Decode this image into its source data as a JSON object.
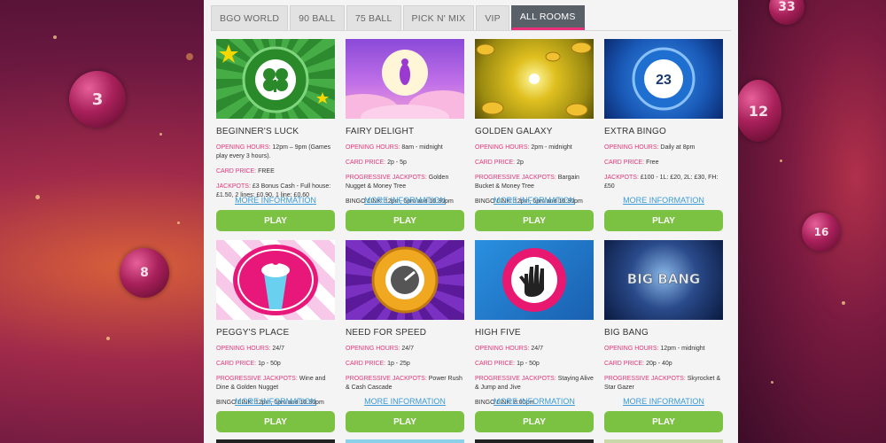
{
  "tabs": [
    {
      "label": "BGO WORLD",
      "active": false
    },
    {
      "label": "90 BALL",
      "active": false
    },
    {
      "label": "75 BALL",
      "active": false
    },
    {
      "label": "PICK N' MIX",
      "active": false
    },
    {
      "label": "VIP",
      "active": false
    },
    {
      "label": "ALL ROOMS",
      "active": true
    }
  ],
  "labels": {
    "opening_hours": "OPENING HOURS:",
    "card_price": "CARD PRICE:",
    "progressive_jackpots": "PROGRESSIVE JACKPOTS:",
    "jackpots": "JACKPOTS:",
    "more_info": "MORE INFORMATION",
    "play": "PLAY"
  },
  "rooms": [
    {
      "title": "BEGINNER'S LUCK",
      "hours": "12pm – 9pm (Games play every 3 hours).",
      "price": "FREE",
      "jackpot_label": "JACKPOTS:",
      "jackpots": "£3 Bonus Cash - Full house: £1.50, 2 lines: £0.90, 1 line: £0.60",
      "bingo_line": ""
    },
    {
      "title": "FAIRY DELIGHT",
      "hours": "8am - midnight",
      "price": "2p - 5p",
      "jackpot_label": "PROGRESSIVE JACKPOTS:",
      "jackpots": "Golden Nugget & Money Tree",
      "bingo_line": "BINGO LINK: 12pm, 6pm and 10:30pm"
    },
    {
      "title": "GOLDEN GALAXY",
      "hours": "2pm - midnight",
      "price": "2p",
      "jackpot_label": "PROGRESSIVE JACKPOTS:",
      "jackpots": "Bargain Bucket & Money Tree",
      "bingo_line": "BINGO LINK: 12pm, 6pm and 10:30pm"
    },
    {
      "title": "EXTRA BINGO",
      "hours": "Daily at 8pm",
      "price": "Free",
      "jackpot_label": "JACKPOTS:",
      "jackpots": "£100 - 1L: £20, 2L: £30, FH: £50",
      "bingo_line": ""
    },
    {
      "title": "PEGGY'S PLACE",
      "hours": "24/7",
      "price": "1p - 50p",
      "jackpot_label": "PROGRESSIVE JACKPOTS:",
      "jackpots": "Wine and Dine & Golden Nugget",
      "bingo_line": "BINGO LINK: 12pm, 6pm and 10:30pm"
    },
    {
      "title": "NEED FOR SPEED",
      "hours": "24/7",
      "price": "1p - 25p",
      "jackpot_label": "PROGRESSIVE JACKPOTS:",
      "jackpots": "Power Rush & Cash Cascade",
      "bingo_line": ""
    },
    {
      "title": "HIGH FIVE",
      "hours": "24/7",
      "price": "1p - 50p",
      "jackpot_label": "PROGRESSIVE JACKPOTS:",
      "jackpots": "Staying Alive & Jump and Jive",
      "bingo_line": "BINGO LINK: 8:00pm"
    },
    {
      "title": "BIG BANG",
      "hours": "12pm - midnight",
      "price": "20p - 40p",
      "jackpot_label": "PROGRESSIVE JACKPOTS:",
      "jackpots": "Skyrocket & Star Gazer",
      "bingo_line": ""
    }
  ],
  "thumb_text": {
    "extra_bingo_number": "23",
    "big_bang_logo": "BIG BANG"
  },
  "background_balls": [
    "3",
    "33",
    "12",
    "8",
    "16"
  ],
  "colors": {
    "accent_pink": "#e2377a",
    "play_green": "#7cc242",
    "link_blue": "#3a9ad8",
    "active_tab": "#5a6068"
  }
}
